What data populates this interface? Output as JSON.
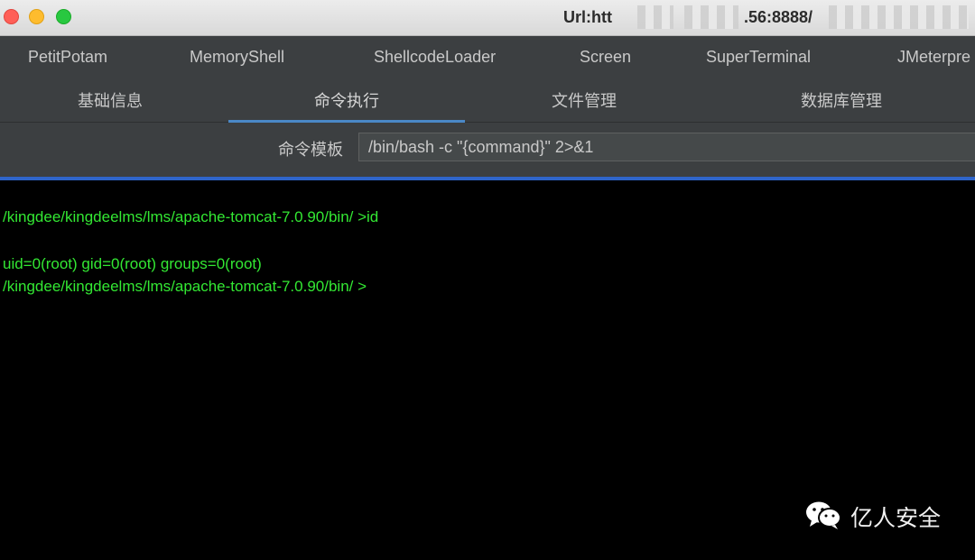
{
  "window": {
    "title": "Url:htt",
    "title_suffix": ".56:8888/"
  },
  "plugins": [
    {
      "label": "PetitPotam"
    },
    {
      "label": "MemoryShell"
    },
    {
      "label": "ShellcodeLoader"
    },
    {
      "label": "Screen"
    },
    {
      "label": "SuperTerminal"
    },
    {
      "label": "JMeterpre"
    }
  ],
  "tabs": [
    {
      "label": "基础信息"
    },
    {
      "label": "命令执行",
      "active": true
    },
    {
      "label": "文件管理"
    },
    {
      "label": "数据库管理"
    }
  ],
  "command": {
    "template_label": "命令模板",
    "template_value": "/bin/bash -c \"{command}\" 2>&1"
  },
  "terminal": {
    "lines": [
      "/kingdee/kingdeelms/lms/apache-tomcat-7.0.90/bin/ >id",
      "",
      "uid=0(root) gid=0(root) groups=0(root)",
      "/kingdee/kingdeelms/lms/apache-tomcat-7.0.90/bin/ >"
    ],
    "text_color": "#33e833"
  },
  "watermark": {
    "text": "亿人安全",
    "icon": "wechat-icon"
  },
  "colors": {
    "accent": "#2f65ca",
    "panel": "#3c3f41"
  }
}
